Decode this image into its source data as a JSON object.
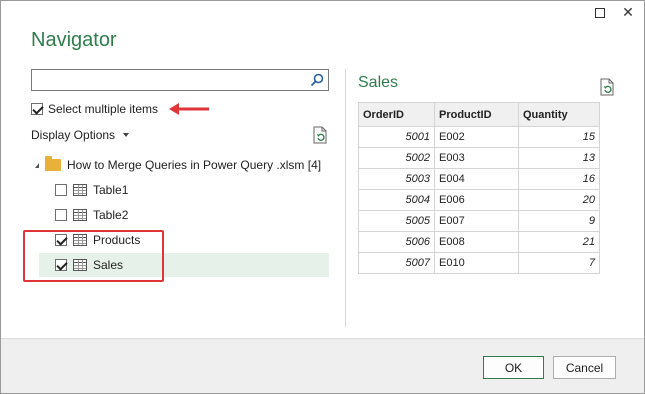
{
  "window": {
    "title": "Navigator"
  },
  "search": {
    "placeholder": "",
    "value": ""
  },
  "select_multiple": {
    "label": "Select multiple items",
    "checked": true
  },
  "display_options": {
    "label": "Display Options"
  },
  "tree": {
    "root_label": "How to Merge Queries in Power Query .xlsm [4]",
    "items": [
      {
        "label": "Table1",
        "checked": false,
        "selected": false
      },
      {
        "label": "Table2",
        "checked": false,
        "selected": false
      },
      {
        "label": "Products",
        "checked": true,
        "selected": false
      },
      {
        "label": "Sales",
        "checked": true,
        "selected": true
      }
    ]
  },
  "preview": {
    "title": "Sales",
    "columns": [
      "OrderID",
      "ProductID",
      "Quantity"
    ],
    "rows": [
      [
        "5001",
        "E002",
        "15"
      ],
      [
        "5002",
        "E003",
        "13"
      ],
      [
        "5003",
        "E004",
        "16"
      ],
      [
        "5004",
        "E006",
        "20"
      ],
      [
        "5005",
        "E007",
        "9"
      ],
      [
        "5006",
        "E008",
        "21"
      ],
      [
        "5007",
        "E010",
        "7"
      ]
    ]
  },
  "footer": {
    "ok_label": "OK",
    "cancel_label": "Cancel"
  },
  "colors": {
    "accent_green": "#2f7d4a",
    "annotation_red": "#e0363a",
    "selected_bg": "#e6f2e9"
  },
  "icons": {
    "search": "search-icon",
    "refresh": "refresh-icon",
    "folder": "folder-icon",
    "table": "table-icon"
  }
}
